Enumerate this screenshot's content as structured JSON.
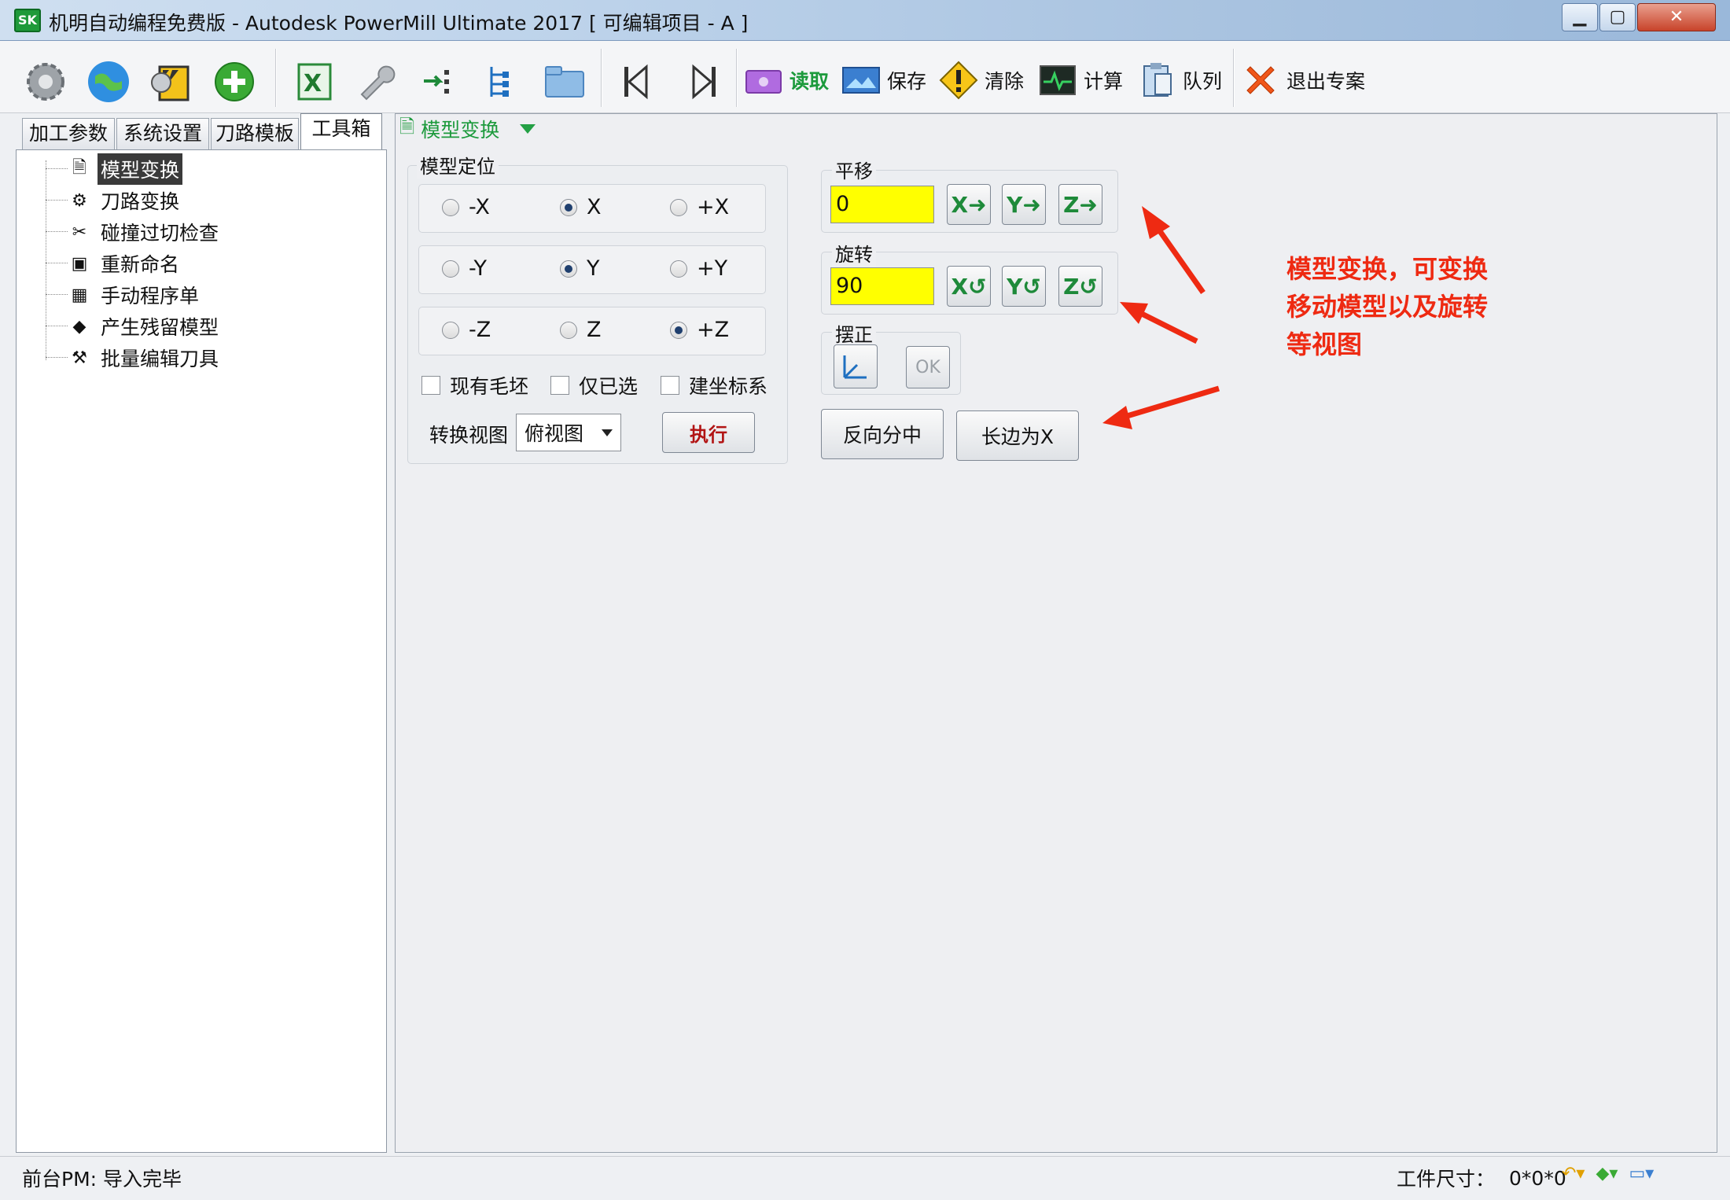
{
  "window": {
    "title": "机明自动编程免费版 - Autodesk PowerMill Ultimate 2017    [ 可编辑项目 - A ]",
    "app_icon_text": "SK",
    "minimize": "▁",
    "maximize": "▢",
    "close": "✕"
  },
  "toolbar": {
    "read": "读取",
    "save": "保存",
    "clear": "清除",
    "calculate": "计算",
    "queue": "队列",
    "exit": "退出专案"
  },
  "tabs": [
    "加工参数",
    "系统设置",
    "刀路模板",
    "工具箱"
  ],
  "tree": [
    {
      "label": "模型变换",
      "icon": "transform-model-icon",
      "glyph": "🗎"
    },
    {
      "label": "刀路变换",
      "icon": "toolpath-transform-icon",
      "glyph": "⚙"
    },
    {
      "label": "碰撞过切检查",
      "icon": "collision-check-icon",
      "glyph": "✂"
    },
    {
      "label": "重新命名",
      "icon": "rename-icon",
      "glyph": "▣"
    },
    {
      "label": "手动程序单",
      "icon": "program-sheet-icon",
      "glyph": "▦"
    },
    {
      "label": "产生残留模型",
      "icon": "stock-model-icon",
      "glyph": "◆"
    },
    {
      "label": "批量编辑刀具",
      "icon": "batch-edit-tools-icon",
      "glyph": "⚒"
    }
  ],
  "panel": {
    "header": "模型变换",
    "positioning": {
      "label": "模型定位",
      "rows": [
        [
          {
            "label": "-X",
            "on": false
          },
          {
            "label": "X",
            "on": true
          },
          {
            "label": "+X",
            "on": false
          }
        ],
        [
          {
            "label": "-Y",
            "on": false
          },
          {
            "label": "Y",
            "on": true
          },
          {
            "label": "+Y",
            "on": false
          }
        ],
        [
          {
            "label": "-Z",
            "on": false
          },
          {
            "label": "Z",
            "on": false
          },
          {
            "label": "+Z",
            "on": true
          }
        ]
      ],
      "checkboxes": [
        "现有毛坯",
        "仅已选",
        "建坐标系"
      ],
      "convert_view_label": "转换视图",
      "convert_view_value": "俯视图",
      "execute": "执行"
    },
    "translate": {
      "label": "平移",
      "value": "0",
      "buttons": [
        "X",
        "Y",
        "Z"
      ]
    },
    "rotate": {
      "label": "旋转",
      "value": "90",
      "buttons": [
        "X",
        "Y",
        "Z"
      ]
    },
    "align": {
      "label": "摆正",
      "ok": "OK"
    },
    "reverse_center": "反向分中",
    "long_edge_x": "长边为X"
  },
  "annotation": {
    "line1": "模型变换，可变换",
    "line2": "移动模型以及旋转",
    "line3": "等视图"
  },
  "status": {
    "left": "前台PM: 导入完毕",
    "workpiece_label": "工件尺寸：",
    "workpiece_value": "0*0*0"
  },
  "colors": {
    "accent_green": "#1c9a3c",
    "annotation_red": "#ee2a12",
    "input_yellow": "#ffff00"
  }
}
